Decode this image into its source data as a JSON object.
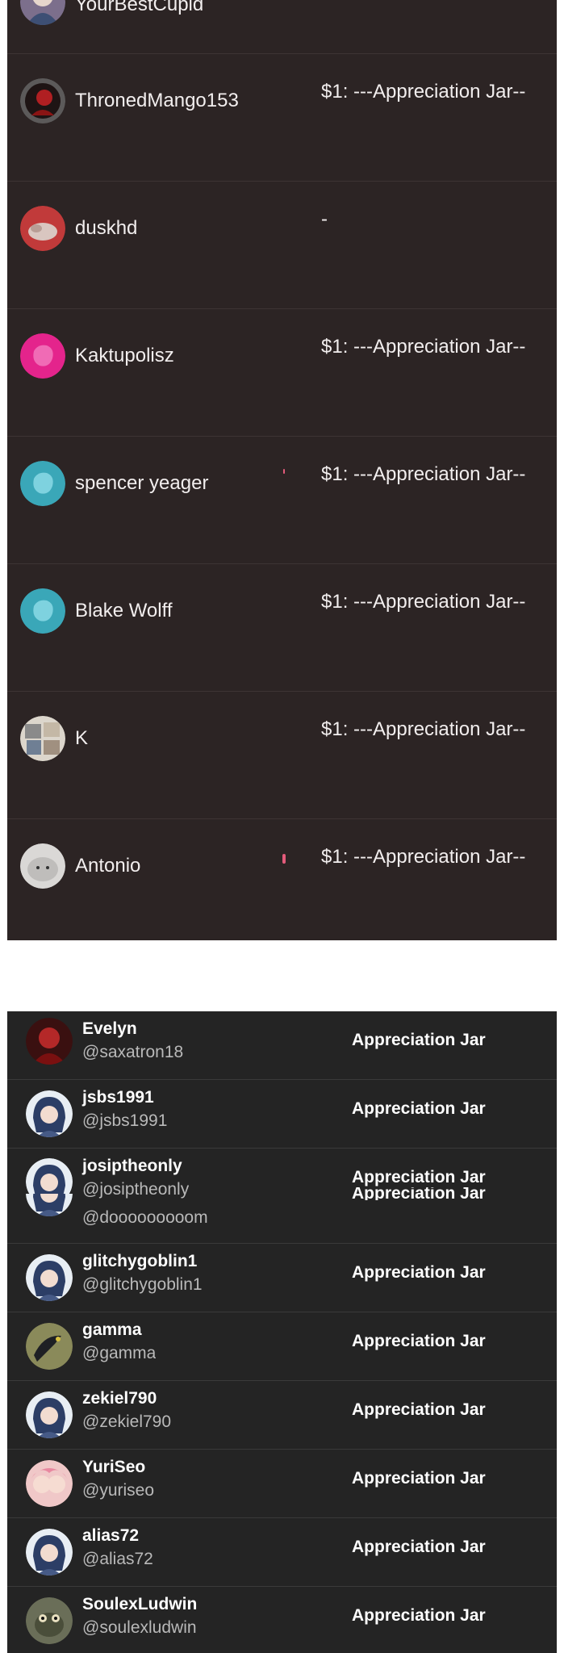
{
  "top_list": {
    "partial_name": "YourBestCupid",
    "rows": [
      {
        "name": "ThronedMango153",
        "amount": "$1: ---Appreciation Jar--",
        "avatar_icon": "dark-red-character-avatar"
      },
      {
        "name": "duskhd",
        "amount": "-",
        "avatar_icon": "sleeping-cat-avatar"
      },
      {
        "name": "Kaktupolisz",
        "amount": "$1: ---Appreciation Jar--",
        "avatar_icon": "pink-blob-avatar"
      },
      {
        "name": "spencer yeager",
        "amount": "$1: ---Appreciation Jar--",
        "avatar_icon": "teal-blob-avatar"
      },
      {
        "name": "Blake Wolff",
        "amount": "$1: ---Appreciation Jar--",
        "avatar_icon": "teal-blob-avatar"
      },
      {
        "name": "K",
        "amount": "$1: ---Appreciation Jar--",
        "avatar_icon": "collage-avatar"
      },
      {
        "name": "Antonio",
        "amount": "$1: ---Appreciation Jar--",
        "avatar_icon": "seal-photo-avatar"
      }
    ],
    "colors": {
      "background": "#2c2424",
      "text": "#f2eeee",
      "accent_mark": "#e45b7b"
    }
  },
  "bottom_list": {
    "rows": [
      {
        "name": "Evelyn",
        "handle": "@saxatron18",
        "tier": "Appreciation Jar",
        "avatar_icon": "red-character-avatar"
      },
      {
        "name": "jsbs1991",
        "handle": "@jsbs1991",
        "tier": "Appreciation Jar",
        "avatar_icon": "default-anime-avatar"
      },
      {
        "name": "josiptheonly",
        "handle": "@josiptheonly",
        "tier": "Appreciation Jar",
        "avatar_icon": "default-anime-avatar"
      },
      {
        "name": "",
        "handle": "@dooooooooom",
        "tier": "Appreciation Jar",
        "avatar_icon": "default-anime-avatar"
      },
      {
        "name": "glitchygoblin1",
        "handle": "@glitchygoblin1",
        "tier": "Appreciation Jar",
        "avatar_icon": "default-anime-avatar"
      },
      {
        "name": "gamma",
        "handle": "@gamma",
        "tier": "Appreciation Jar",
        "avatar_icon": "dark-bird-avatar"
      },
      {
        "name": "zekiel790",
        "handle": "@zekiel790",
        "tier": "Appreciation Jar",
        "avatar_icon": "default-anime-avatar"
      },
      {
        "name": "YuriSeo",
        "handle": "@yuriseo",
        "tier": "Appreciation Jar",
        "avatar_icon": "pink-anime-avatar"
      },
      {
        "name": "alias72",
        "handle": "@alias72",
        "tier": "Appreciation Jar",
        "avatar_icon": "default-anime-avatar"
      },
      {
        "name": "SoulexLudwin",
        "handle": "@soulexludwin",
        "tier": "Appreciation Jar",
        "avatar_icon": "frog-avatar"
      }
    ],
    "colors": {
      "background": "#242424",
      "name": "#ffffff",
      "handle": "#b9b9b9"
    }
  }
}
